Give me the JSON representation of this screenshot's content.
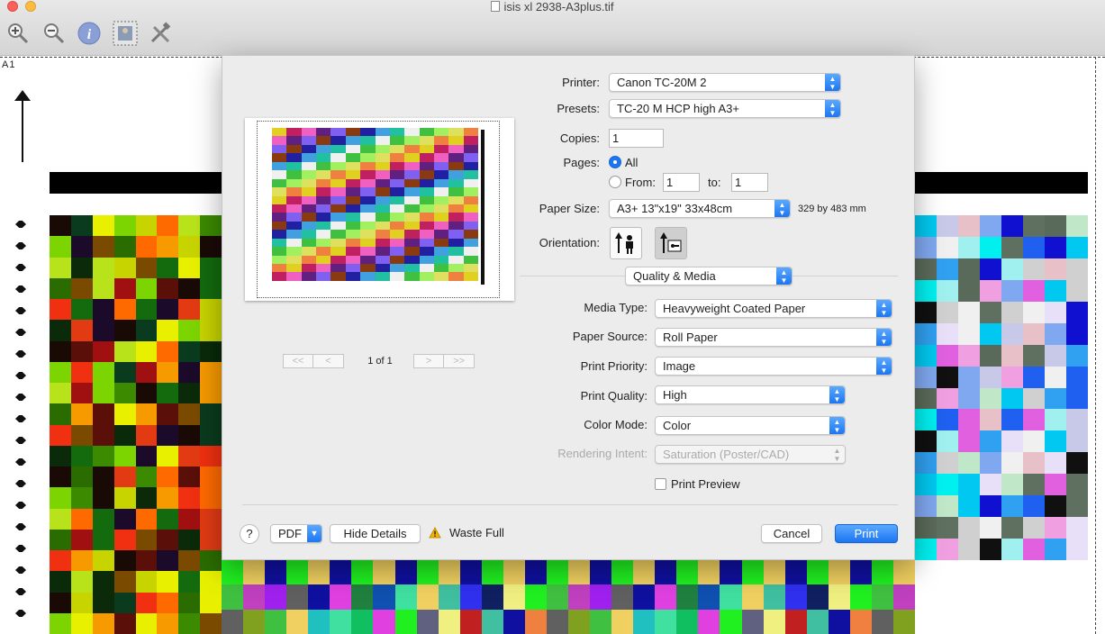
{
  "window": {
    "title": "isis xl 2938-A3plus.tif"
  },
  "toolbar": {
    "icons": [
      "zoom-in-icon",
      "zoom-out-icon",
      "info-icon",
      "thumbnail-icon",
      "tools-icon"
    ]
  },
  "image": {
    "corner_label": "A1"
  },
  "preview": {
    "page_count": "1 of 1",
    "first": "<<",
    "prev": "<",
    "next": ">",
    "last": ">>"
  },
  "printer": {
    "label": "Printer:",
    "value": "Canon TC-20M 2"
  },
  "presets": {
    "label": "Presets:",
    "value": "TC-20 M HCP high A3+"
  },
  "copies": {
    "label": "Copies:",
    "value": "1"
  },
  "pages": {
    "label": "Pages:",
    "all_label": "All",
    "from_label": "From:",
    "from_value": "1",
    "to_label": "to:",
    "to_value": "1",
    "selected": "All"
  },
  "paper_size": {
    "label": "Paper Size:",
    "value": "A3+ 13\"x19\" 33x48cm",
    "dimensions": "329 by 483 mm"
  },
  "orientation": {
    "label": "Orientation:",
    "selected": "landscape"
  },
  "section": {
    "value": "Quality & Media"
  },
  "media_type": {
    "label": "Media Type:",
    "value": "Heavyweight Coated Paper"
  },
  "paper_source": {
    "label": "Paper Source:",
    "value": "Roll Paper"
  },
  "print_priority": {
    "label": "Print Priority:",
    "value": "Image"
  },
  "print_quality": {
    "label": "Print Quality:",
    "value": "High"
  },
  "color_mode": {
    "label": "Color Mode:",
    "value": "Color"
  },
  "rendering_intent": {
    "label": "Rendering Intent:",
    "value": "Saturation (Poster/CAD)",
    "enabled": false
  },
  "print_preview": {
    "label": "Print Preview",
    "checked": false
  },
  "footer": {
    "help": "?",
    "pdf": "PDF",
    "hide_details": "Hide Details",
    "warning": "Waste Full",
    "cancel": "Cancel",
    "print": "Print"
  },
  "colors": {
    "accent": "#1c76f2",
    "dialog_bg": "#ececec"
  }
}
